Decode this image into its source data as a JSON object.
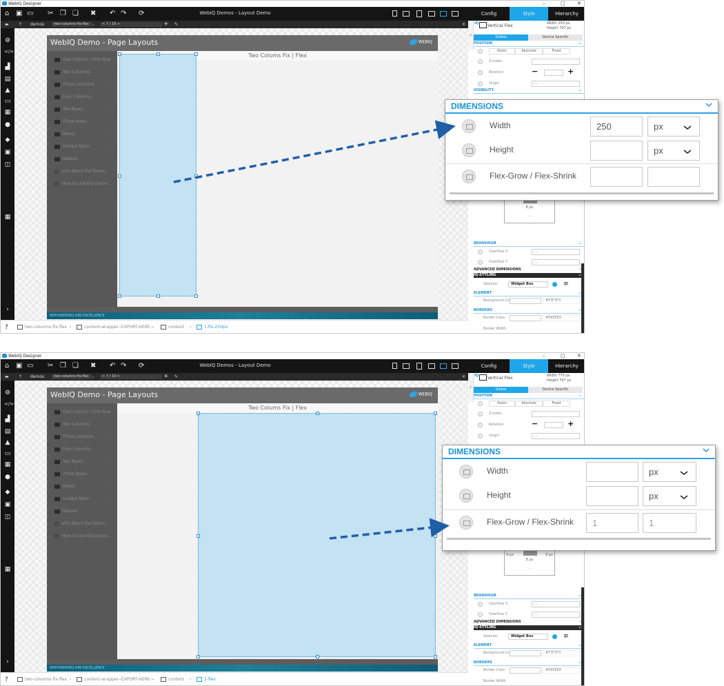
{
  "app": {
    "window_title": "WebIQ Designer",
    "doc_title": "WebIQ Demos - Layout Demo",
    "window_controls": [
      "–",
      "□",
      "✕"
    ],
    "right_tabs": [
      "Config",
      "Style",
      "Hierarchy"
    ],
    "active_right_tab": "Style",
    "accent": "#1fa6e8"
  },
  "nav_bar": {
    "up": "↑",
    "project": "demos",
    "page": "two-columns-fix-flex",
    "page_counter": "< 7 / 33 >",
    "add": "+",
    "edit": "✎",
    "close": "✕"
  },
  "demo": {
    "title": "WebIQ Demo - Page Layouts",
    "logo": "WEBIQ",
    "main_heading": "Two Colums Fix | Flex",
    "footer": "EMPOWERING HMI EXCELLENCE",
    "nav_items": [
      {
        "label": "One Column / One Row",
        "chevron": ""
      },
      {
        "label": "Two Columns",
        "chevron": "›"
      },
      {
        "label": "Three Columns",
        "chevron": "›"
      },
      {
        "label": "Four Columns",
        "chevron": ""
      },
      {
        "label": "Two Rows",
        "chevron": "›"
      },
      {
        "label": "Three Rows",
        "chevron": ""
      },
      {
        "label": "Mixed",
        "chevron": "›"
      },
      {
        "label": "Golden Ratio",
        "chevron": "›"
      },
      {
        "label": "Nested",
        "chevron": ""
      },
      {
        "label": "Info About the Demo...",
        "chevron": ""
      },
      {
        "label": "How to Use the Demo...",
        "chevron": ""
      }
    ]
  },
  "crumbs": {
    "help": "?",
    "items": [
      "two-columns-fix-flex",
      "content-wrapper--EXPORT-HERE--",
      "content"
    ],
    "sep": "›"
  },
  "panel": {
    "handle": "‹",
    "widget_name": "Vertical Flex",
    "width_label": "Width",
    "height_label": "Height",
    "tab_global": "Global",
    "tab_device": "Device Specific",
    "position_title": "POSITION",
    "pos_static": "Static",
    "pos_absolute": "Absolute",
    "pos_fixed": "Fixed",
    "z_index": "Z-Index",
    "rotation": "Rotation",
    "origin": "Origin",
    "origin_value": "...",
    "minus": "−",
    "plus": "+",
    "visibility_title": "VISIBILITY",
    "bm_8": "8 px",
    "bm_dash": "-",
    "behaviour_title": "BEHAVIOUR",
    "overflow_x": "Overflow X",
    "overflow_y": "Overflow Y",
    "overflow_value": "...",
    "adv_dims": "ADVANCED DIMENSIONS",
    "adv_chev": "‹",
    "iq_styling": "IQ-STYLING",
    "selector": "Selector",
    "selector_value": "Widget Box",
    "element_title": "ELEMENT",
    "bg_color_label": "Background Color",
    "bg_color_value": "#F3F3F3",
    "borders_title": "BORDERS",
    "border_color_label": "Border Color",
    "border_color_value": "#E6E6E6",
    "border_width_label": "Border Width"
  },
  "popup": {
    "title": "DIMENSIONS",
    "width_label": "Width",
    "height_label": "Height",
    "flex_label": "Flex-Grow / Flex-Shrink"
  },
  "screens": [
    {
      "selected_crumb": "1-fix-250px",
      "dims_width": "250 px",
      "dims_height": "797 px",
      "width_value": "250",
      "width_unit": "px",
      "height_value": "",
      "height_unit": "px",
      "flex_grow": "",
      "flex_shrink": ""
    },
    {
      "selected_crumb": "2-flex",
      "dims_width": "775 px",
      "dims_height": "797 px",
      "width_value": "",
      "width_unit": "px",
      "height_value": "",
      "height_unit": "px",
      "flex_grow": "1",
      "flex_shrink": "1"
    }
  ]
}
